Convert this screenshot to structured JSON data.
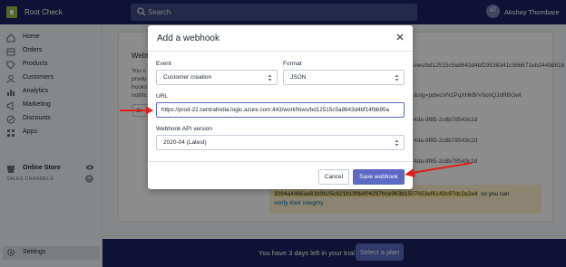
{
  "topbar": {
    "store_name": "Root Check",
    "search_placeholder": "Search",
    "avatar_initials": "AT",
    "user_name": "Akshay Thombare"
  },
  "sidebar": {
    "items": [
      {
        "label": "Home",
        "icon": "home-icon"
      },
      {
        "label": "Orders",
        "icon": "orders-icon"
      },
      {
        "label": "Products",
        "icon": "products-icon"
      },
      {
        "label": "Customers",
        "icon": "customers-icon"
      },
      {
        "label": "Analytics",
        "icon": "analytics-icon"
      },
      {
        "label": "Marketing",
        "icon": "marketing-icon"
      },
      {
        "label": "Discounts",
        "icon": "discounts-icon"
      },
      {
        "label": "Apps",
        "icon": "apps-icon"
      }
    ],
    "channels_heading": "SALES CHANNELS",
    "online_store": "Online Store",
    "settings": "Settings"
  },
  "background": {
    "section_title": "Webh",
    "desc_lines": [
      "You c",
      "produ",
      "hooks",
      "notific"
    ],
    "button_fragment": "Cr",
    "webhook_urls": [
      "ows/bd12515c5a8643d4bf29538341c586671eb2449d81b",
      "&sig=pdwcVN1PqXHkBrV8onQJdRBGwt",
      "4da-9f85-2c8b78543c2d",
      "4da-9f85-2c8b78543c2d",
      "4da-9f85-2c8b78543c2d"
    ],
    "signature_key": "3094a4466aa61b0b25c621b19fdef04297bce963b1507653ef6143c97dc2e2e4",
    "signature_after": "so you can",
    "verify_link": "verify their integrity."
  },
  "trial": {
    "text": "You have 3 days left in your trial",
    "button": "Select a plan"
  },
  "modal": {
    "title": "Add a webhook",
    "event_label": "Event",
    "event_value": "Customer creation",
    "format_label": "Format",
    "format_value": "JSON",
    "url_label": "URL",
    "url_value": "https://prod-22.centralindia.logic.azure.com:443/workflows/bd12515c5a8643d4bf14fbb95a",
    "api_label": "Webhook API version",
    "api_value": "2020-04 (Latest)",
    "cancel": "Cancel",
    "save": "Save webhook"
  },
  "colors": {
    "topbar": "#1c2260",
    "primary_button": "#5c6ac4",
    "annotation_arrow": "#e0201b",
    "highlight": "#ffea8a"
  }
}
